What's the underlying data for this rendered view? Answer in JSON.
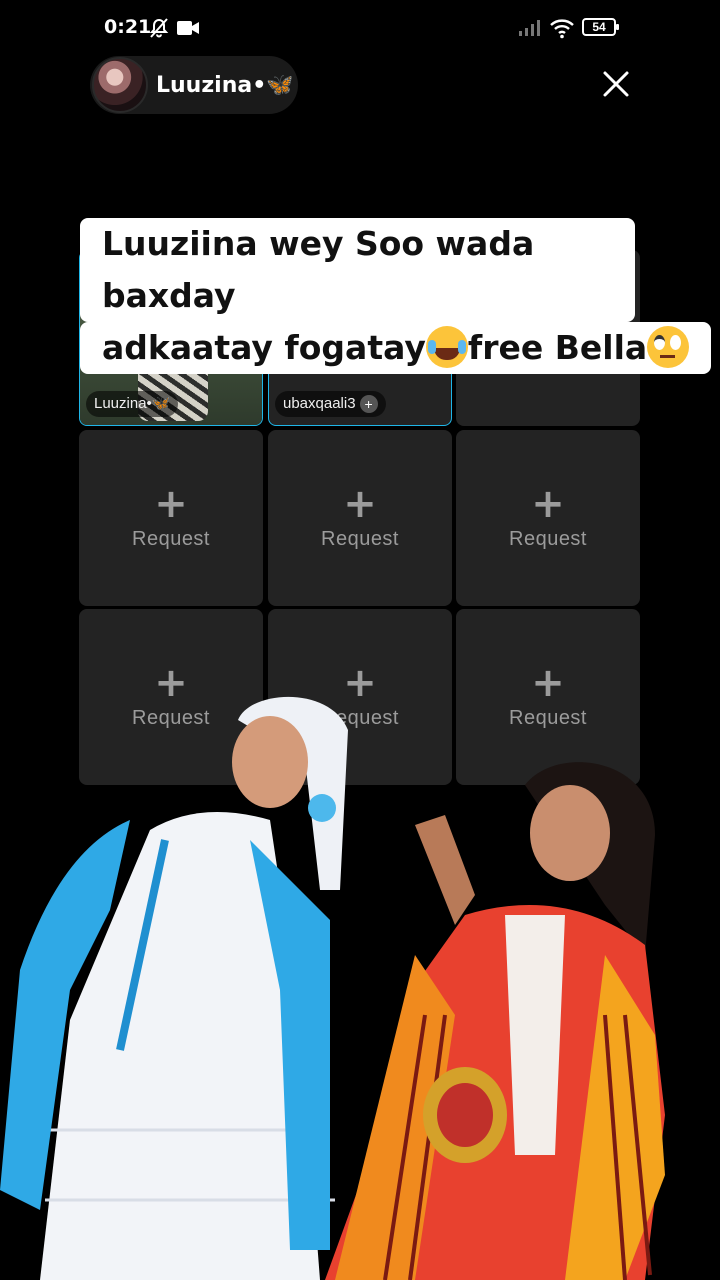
{
  "status": {
    "time": "0:21",
    "battery": "54"
  },
  "host": {
    "name": "Luuzina•🦋"
  },
  "caption": {
    "line1": "Luuziina wey Soo wada baxday",
    "line2a": "adkaatay fogatay",
    "line2b": "free Bella"
  },
  "grid": {
    "cell1_name": "Luuzina•🦋",
    "cell2_name": "ubaxqaali3",
    "request_label": "Request",
    "plus": "+"
  },
  "icons": [
    "mute-bell-icon",
    "video-camera-icon",
    "signal-icon",
    "wifi-icon",
    "battery-icon",
    "close-icon"
  ],
  "colors": {
    "accent": "#1fb6e8",
    "cell_bg": "#232323",
    "request_text": "#9b9b9b"
  }
}
